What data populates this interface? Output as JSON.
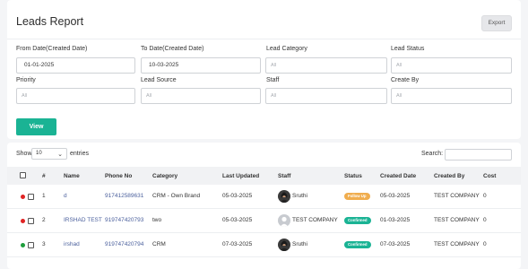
{
  "header": {
    "title": "Leads Report",
    "export_label": "Export"
  },
  "filters": {
    "from_date": {
      "label": "From Date(Created Date)",
      "value": "01-01-2025"
    },
    "to_date": {
      "label": "To Date(Created Date)",
      "value": "10-03-2025"
    },
    "lead_category": {
      "label": "Lead Category",
      "placeholder": "All"
    },
    "lead_status": {
      "label": "Lead Status",
      "placeholder": "All"
    },
    "priority": {
      "label": "Priority",
      "placeholder": "All"
    },
    "lead_source": {
      "label": "Lead Source",
      "placeholder": "All"
    },
    "staff": {
      "label": "Staff",
      "placeholder": "All"
    },
    "created_by": {
      "label": "Create By",
      "placeholder": "All"
    },
    "view_label": "View"
  },
  "table_controls": {
    "show_label": "Show",
    "page_length": "10",
    "entries_label": "entries",
    "search_label": "Search:"
  },
  "table": {
    "columns": [
      "#",
      "Name",
      "Phone No",
      "Category",
      "Last Updated",
      "Staff",
      "Status",
      "Created Date",
      "Created By",
      "Cost"
    ],
    "rows": [
      {
        "num": "1",
        "name": "d",
        "phone": "917412589631",
        "category": "CRM - Own Brand",
        "last_updated": "05-03-2025",
        "staff": "Sruthi",
        "status": "Follow Up",
        "status_color": "#f0ad4e",
        "created_date": "05-03-2025",
        "created_by": "TEST COMPANY",
        "cost": "0",
        "priority_color": "#e02424"
      },
      {
        "num": "2",
        "name": "IRSHAD TEST",
        "phone": "919747420793",
        "category": "two",
        "last_updated": "05-03-2025",
        "staff": "TEST COMPANY",
        "status": "Confirmed",
        "status_color": "#1ab394",
        "created_date": "01-03-2025",
        "created_by": "TEST COMPANY",
        "cost": "0",
        "priority_color": "#e02424"
      },
      {
        "num": "3",
        "name": "irshad",
        "phone": "919747420794",
        "category": "CRM",
        "last_updated": "07-03-2025",
        "staff": "Sruthi",
        "status": "Confirmed",
        "status_color": "#1ab394",
        "created_date": "07-03-2025",
        "created_by": "TEST COMPANY",
        "cost": "0",
        "priority_color": "#1e9e3c"
      }
    ]
  }
}
